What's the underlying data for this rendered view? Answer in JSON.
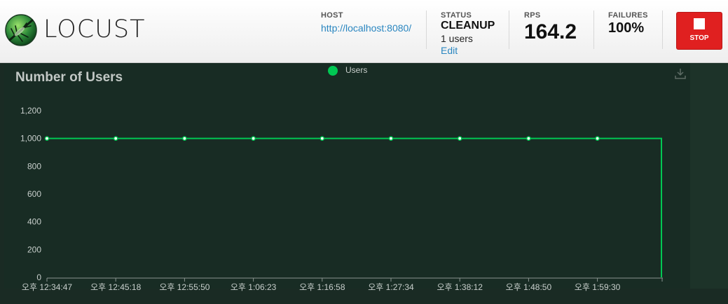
{
  "header": {
    "brand": "LOCUST",
    "host": {
      "label": "HOST",
      "url": "http://localhost:8080/"
    },
    "status": {
      "label": "STATUS",
      "value": "CLEANUP",
      "users": "1 users",
      "edit": "Edit"
    },
    "rps": {
      "label": "RPS",
      "value": "164.2"
    },
    "failures": {
      "label": "FAILURES",
      "value": "100%"
    },
    "stop": {
      "label": "STOP"
    }
  },
  "chart": {
    "title": "Number of Users",
    "legend": "Users",
    "download_icon": "download-icon"
  },
  "colors": {
    "series": "#00c853",
    "panel": "#182c24",
    "stop": "#e02020",
    "link": "#2a86c0"
  },
  "chart_data": {
    "type": "line",
    "title": "Number of Users",
    "xlabel": "",
    "ylabel": "",
    "ylim": [
      0,
      1200
    ],
    "yticks": [
      "0",
      "200",
      "400",
      "600",
      "800",
      "1,000",
      "1,200"
    ],
    "ytick_values": [
      0,
      200,
      400,
      600,
      800,
      1000,
      1200
    ],
    "x": [
      "오후 12:34:47",
      "오후 12:45:18",
      "오후 12:55:50",
      "오후 1:06:23",
      "오후 1:16:58",
      "오후 1:27:34",
      "오후 1:38:12",
      "오후 1:48:50",
      "오후 1:59:30"
    ],
    "x_end_drop": true,
    "series": [
      {
        "name": "Users",
        "values": [
          1000,
          1000,
          1000,
          1000,
          1000,
          1000,
          1000,
          1000,
          1000
        ]
      }
    ],
    "grid": false,
    "legend": "top-center"
  }
}
